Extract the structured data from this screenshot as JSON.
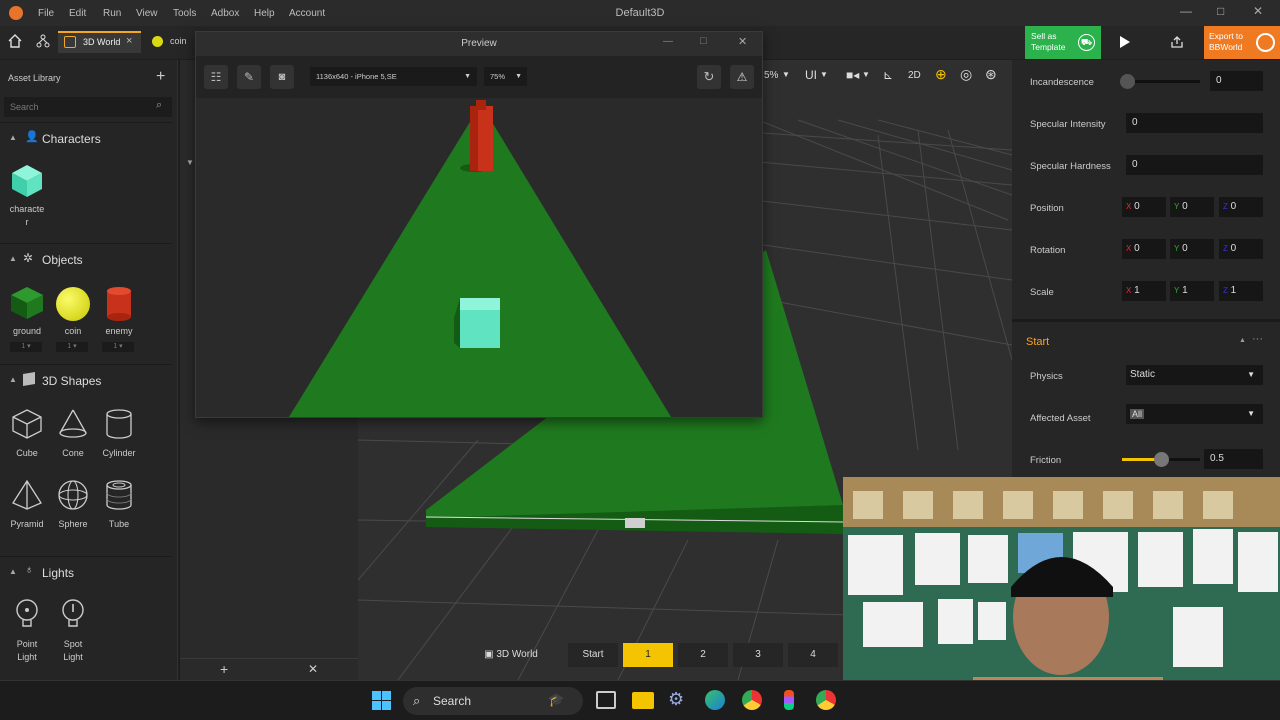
{
  "titlebar": {
    "menus": [
      "File",
      "Edit",
      "Run",
      "View",
      "Tools",
      "Adbox",
      "Help",
      "Account"
    ],
    "title": "Default3D"
  },
  "toolbar": {
    "tabs": [
      {
        "label": "3D World"
      },
      {
        "label": "coin"
      }
    ],
    "sell_label_1": "Sell as",
    "sell_label_2": "Template",
    "export_label_1": "Export to",
    "export_label_2": "BBWorld"
  },
  "asset_library": {
    "title": "Asset Library",
    "search_placeholder": "Search",
    "sections": {
      "characters": {
        "title": "Characters",
        "items": [
          {
            "label_1": "characte",
            "label_2": "r"
          }
        ]
      },
      "objects": {
        "title": "Objects",
        "items": [
          {
            "label": "ground",
            "count": "1"
          },
          {
            "label": "coin",
            "count": "1"
          },
          {
            "label": "enemy",
            "count": "1"
          }
        ]
      },
      "shapes": {
        "title": "3D Shapes",
        "items": [
          {
            "label": "Cube"
          },
          {
            "label": "Cone"
          },
          {
            "label": "Cylinder"
          },
          {
            "label": "Pyramid"
          },
          {
            "label": "Sphere"
          },
          {
            "label": "Tube"
          }
        ]
      },
      "lights": {
        "title": "Lights",
        "items": [
          {
            "label_1": "Point",
            "label_2": "Light"
          },
          {
            "label_1": "Spot",
            "label_2": "Light"
          }
        ]
      }
    }
  },
  "preview": {
    "title": "Preview",
    "device": "1136x640 - iPhone 5,SE",
    "zoom": "75%"
  },
  "viewport_toolbar": {
    "zoom_partial": "5%",
    "ui_label": "UI",
    "mode_2d": "2D"
  },
  "properties": {
    "incandescence": {
      "label": "Incandescence",
      "value": "0"
    },
    "specular_intensity": {
      "label": "Specular Intensity",
      "value": "0"
    },
    "specular_hardness": {
      "label": "Specular Hardness",
      "value": "0"
    },
    "position": {
      "label": "Position",
      "x": "0",
      "y": "0",
      "z": "0"
    },
    "rotation": {
      "label": "Rotation",
      "x": "0",
      "y": "0",
      "z": "0"
    },
    "scale": {
      "label": "Scale",
      "x": "1",
      "y": "1",
      "z": "1"
    },
    "axis_x": "X",
    "axis_y": "Y",
    "axis_z": "Z",
    "start_section": "Start",
    "physics": {
      "label": "Physics",
      "value": "Static"
    },
    "affected_asset": {
      "label": "Affected Asset",
      "value": "All"
    },
    "friction": {
      "label": "Friction",
      "value": "0.5",
      "level": 0.5
    }
  },
  "scene_tabs": {
    "world": "3D World",
    "start": "Start",
    "scenes": [
      "1",
      "2",
      "3",
      "4"
    ],
    "active": "1"
  },
  "taskbar": {
    "search": "Search"
  },
  "colors": {
    "accent_green": "#2bb24c",
    "accent_orange": "#f07a22",
    "ground": "#1f7a1f",
    "enemy": "#c8321a",
    "coin": "#e6e61a",
    "character": "#5fe3c0",
    "scene_tab_active": "#f5c400"
  }
}
